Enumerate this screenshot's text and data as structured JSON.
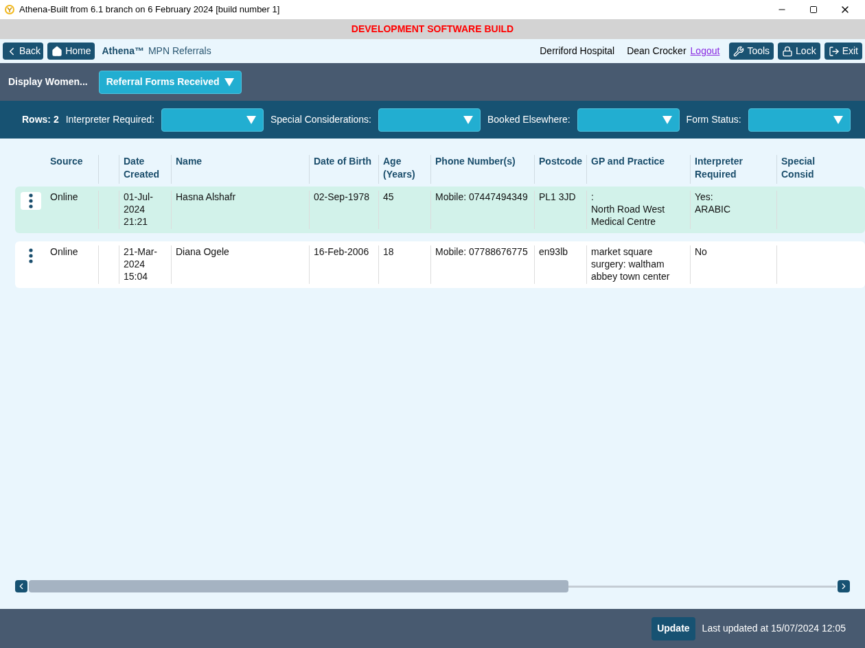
{
  "window": {
    "title": "Athena-Built from 6.1 branch on 6 February 2024 [build number 1]"
  },
  "banner": "DEVELOPMENT SOFTWARE BUILD",
  "nav": {
    "back": "Back",
    "home": "Home",
    "brand": "Athena™",
    "page": "MPN Referrals",
    "site": "Derriford Hospital",
    "user": "Dean Crocker",
    "logout": "Logout",
    "buttons": [
      {
        "kind": "tools",
        "label": "Tools"
      },
      {
        "kind": "lock",
        "label": "Lock"
      },
      {
        "kind": "exit",
        "label": "Exit"
      }
    ]
  },
  "display": {
    "label": "Display Women...",
    "value": "Referral Forms Received"
  },
  "filters": {
    "rows": "Rows: 2",
    "items": [
      {
        "label": "Interpreter Required:"
      },
      {
        "label": "Special Considerations:"
      },
      {
        "label": "Booked Elsewhere:"
      },
      {
        "label": "Form Status:"
      }
    ]
  },
  "table": {
    "columns": [
      {
        "kind": "text",
        "label": "Source"
      },
      {
        "kind": "spacer"
      },
      {
        "kind": "text",
        "label": "Date Created"
      },
      {
        "kind": "text",
        "label": "Name"
      },
      {
        "kind": "text",
        "label": "Date of Birth"
      },
      {
        "kind": "text",
        "label": "Age (Years)"
      },
      {
        "kind": "text",
        "label": "Phone Number(s)"
      },
      {
        "kind": "text",
        "label": "Postcode"
      },
      {
        "kind": "text",
        "label": "GP and Practice"
      },
      {
        "kind": "text",
        "label": "Interpreter Required"
      },
      {
        "kind": "text",
        "label": "Special Consid"
      }
    ],
    "rows": [
      {
        "selected": true,
        "cells": [
          "Online",
          "",
          "01-Jul-2024 21:21",
          "Hasna Alshafr",
          "02-Sep-1978",
          "45",
          "Mobile: 07447494349",
          "PL1 3JD",
          ":\nNorth Road West Medical Centre",
          "Yes:\nARABIC",
          ""
        ]
      },
      {
        "selected": false,
        "cells": [
          "Online",
          "",
          "21-Mar-2024 15:04",
          "Diana Ogele",
          "16-Feb-2006",
          "18",
          "Mobile: 07788676775",
          "en93lb",
          "market square surgery: waltham abbey town center",
          "No",
          ""
        ]
      }
    ]
  },
  "footer": {
    "update": "Update",
    "last_updated": "Last updated at 15/07/2024 12:05"
  }
}
